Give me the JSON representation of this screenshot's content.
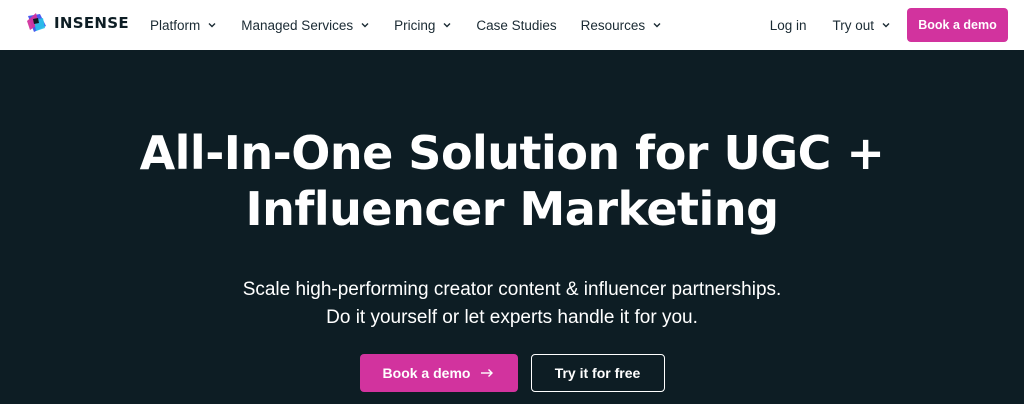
{
  "brand": {
    "name": "INSENSE",
    "accent": "#d2339e",
    "hero_bg": "#0d1d24"
  },
  "nav": {
    "items": [
      {
        "label": "Platform",
        "has_dropdown": true
      },
      {
        "label": "Managed Services",
        "has_dropdown": true
      },
      {
        "label": "Pricing",
        "has_dropdown": true
      },
      {
        "label": "Case Studies",
        "has_dropdown": false
      },
      {
        "label": "Resources",
        "has_dropdown": true
      }
    ],
    "login_label": "Log in",
    "tryout_label": "Try out",
    "book_demo_label": "Book a demo"
  },
  "hero": {
    "title_line1": "All-In-One Solution for UGC +",
    "title_line2": "Influencer Marketing",
    "subtitle_line1": "Scale high-performing creator content & influencer partnerships.",
    "subtitle_line2": "Do it yourself or let experts handle it for you.",
    "primary_cta": "Book a demo",
    "secondary_cta": "Try it for free"
  }
}
